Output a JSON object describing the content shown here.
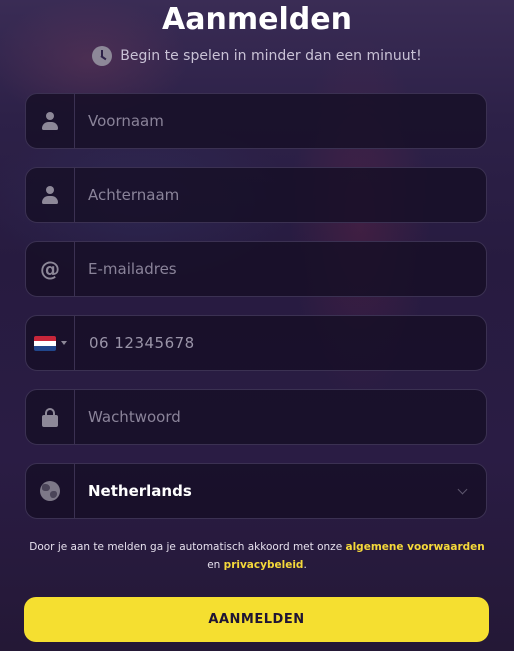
{
  "header": {
    "title": "Aanmelden",
    "subtitle": "Begin te spelen in minder dan een minuut!"
  },
  "form": {
    "first_name": {
      "placeholder": "Voornaam",
      "icon": "user-icon"
    },
    "last_name": {
      "placeholder": "Achternaam",
      "icon": "user-icon"
    },
    "email": {
      "placeholder": "E-mailadres",
      "icon": "at-icon"
    },
    "phone": {
      "placeholder": "06 12345678",
      "country_flag": "nl-flag-icon"
    },
    "password": {
      "placeholder": "Wachtwoord",
      "icon": "lock-icon"
    },
    "country": {
      "value": "Netherlands",
      "icon": "globe-icon"
    }
  },
  "terms": {
    "prefix": "Door je aan te melden ga je automatisch akkoord met onze",
    "terms_link": "algemene voorwaarden",
    "conjunction": "en",
    "privacy_link": "privacybeleid",
    "suffix": "."
  },
  "submit_label": "AANMELDEN",
  "colors": {
    "accent": "#f5df30",
    "link": "#f5d93a",
    "field_bg": "#160f26",
    "field_border": "#3b3152"
  }
}
